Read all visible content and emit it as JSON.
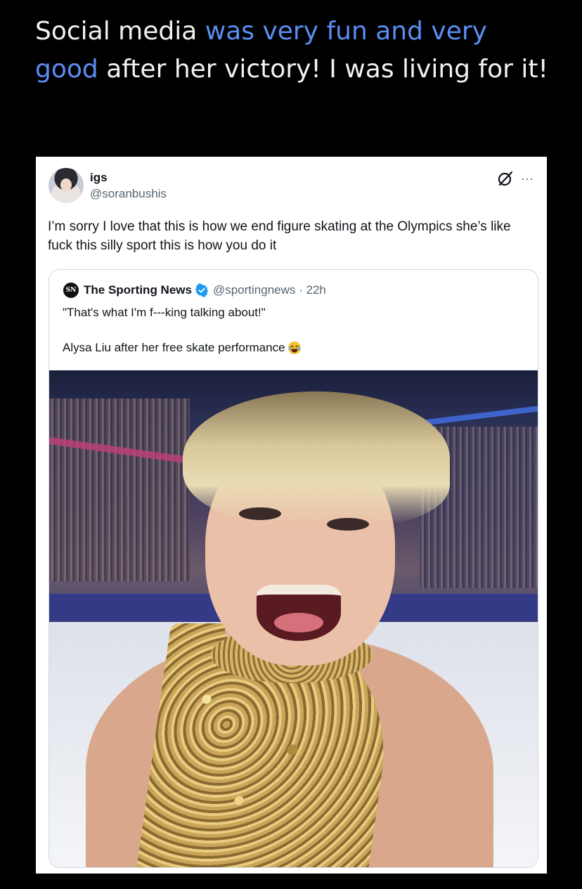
{
  "caption": {
    "part1": "Social media ",
    "highlight": "was very fun and very good",
    "part2": " after her victory! I was living for it!",
    "highlight_color": "#5b8ef5"
  },
  "tweet": {
    "display_name": "igs",
    "handle": "@soranbushis",
    "text": "I’m sorry I love that this is how we end figure skating at the Olympics she’s like fuck this silly sport this is how you do it",
    "icons": [
      "grok-icon",
      "more-icon"
    ],
    "more_label": "···"
  },
  "quote": {
    "logo_text": "SN",
    "name": "The Sporting News",
    "verified_color": "#1d9bf0",
    "handle_time": "@sportingnews · 22h",
    "line1": "\"That's what I'm f---king talking about!\"",
    "line2": "Alysa Liu after her free skate performance",
    "emoji": "joy-emoji-icon"
  }
}
